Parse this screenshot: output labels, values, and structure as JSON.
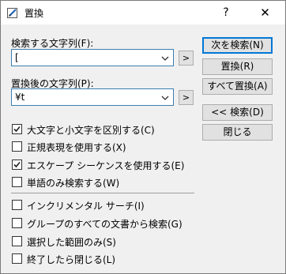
{
  "window": {
    "title": "置換",
    "help_label": "?",
    "close_label": "✕"
  },
  "search": {
    "label": "検索する文字列(F):",
    "value": "[",
    "arrow_label": ">"
  },
  "replace": {
    "label": "置換後の文字列(P):",
    "value": "¥t",
    "arrow_label": ">"
  },
  "buttons": {
    "find_next": "次を検索(N)",
    "replace": "置換(R)",
    "replace_all": "すべて置換(A)",
    "find_prev": "<< 検索(D)",
    "close": "閉じる"
  },
  "options": [
    {
      "label": "大文字と小文字を区別する(C)",
      "checked": true
    },
    {
      "label": "正規表現を使用する(X)",
      "checked": false
    },
    {
      "label": "エスケープ シーケンスを使用する(E)",
      "checked": true
    },
    {
      "label": "単語のみ検索する(W)",
      "checked": false
    }
  ],
  "options2": [
    {
      "label": "インクリメンタル サーチ(I)",
      "checked": false
    },
    {
      "label": "グループのすべての文書から検索(G)",
      "checked": false
    },
    {
      "label": "選択した範囲のみ(S)",
      "checked": false
    },
    {
      "label": "終了したら閉じる(L)",
      "checked": false
    }
  ],
  "icons": {
    "app": "edit-pencil-icon",
    "chevron": "chevron-down-icon",
    "check": "checkmark-icon"
  },
  "colors": {
    "accent": "#0078d7",
    "focus_border": "#3c7fb1"
  }
}
